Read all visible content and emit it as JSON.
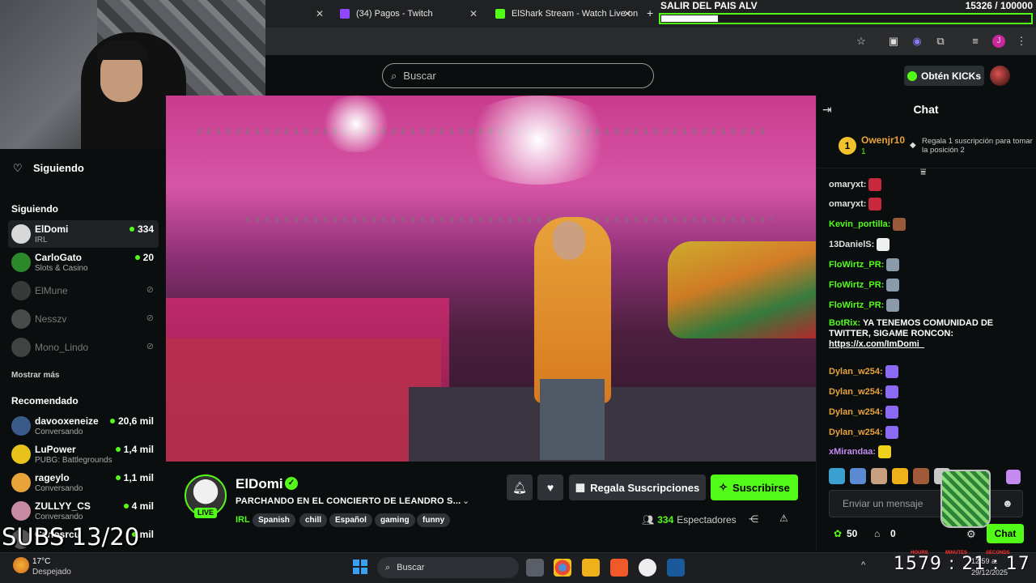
{
  "browser": {
    "tabs": [
      {
        "label": "(34) Pagos - Twitch",
        "favicon_color": "#9146ff"
      },
      {
        "label": "ElShark Stream - Watch Live on",
        "favicon_color": "#53fc18"
      }
    ],
    "new_tab_icon": "plus-icon",
    "toolbar_icons": [
      "star-icon",
      "media-icon",
      "vpn-icon",
      "extensions-icon",
      "reading-list-icon",
      "profile-icon",
      "kebab-menu-icon"
    ],
    "profile_initial": "J"
  },
  "overlay_goal": {
    "title": "SALIR DEL PAIS ALV",
    "count": "15326 / 100000",
    "progress": 0.153
  },
  "header": {
    "search_placeholder": "Buscar",
    "kicks_label": "Obtén KICKs"
  },
  "sidebar": {
    "following_label": "Siguiendo",
    "following_section": "Siguiendo",
    "following": [
      {
        "name": "ElDomi",
        "sub": "IRL",
        "viewers": "334",
        "live": true,
        "color": "#d8d8d8"
      },
      {
        "name": "CarloGato",
        "sub": "Slots & Casino",
        "viewers": "20",
        "live": true,
        "color": "#2a8a2a"
      },
      {
        "name": "ElMune",
        "live": false,
        "color": "#666"
      },
      {
        "name": "Nesszv",
        "live": false,
        "color": "#888"
      },
      {
        "name": "Mono_Lindo",
        "live": false,
        "color": "#777"
      }
    ],
    "show_more": "Mostrar más",
    "recommended_section": "Recomendado",
    "recommended": [
      {
        "name": "davooxeneize",
        "sub": "Conversando",
        "viewers": "20,6 mil",
        "color": "#3a5a8a"
      },
      {
        "name": "LuPower",
        "sub": "PUBG: Battlegrounds",
        "viewers": "1,4 mil",
        "color": "#e8c21a"
      },
      {
        "name": "rageylo",
        "sub": "Conversando",
        "viewers": "1,1 mil",
        "color": "#e8a23a"
      },
      {
        "name": "ZULLYY_CS",
        "sub": "Conversando",
        "viewers": "4 mil",
        "color": "#c88aa0"
      },
      {
        "name": "Carlosrcu",
        "sub": "",
        "viewers": "mil",
        "color": "#555"
      }
    ]
  },
  "stream": {
    "streamer": "ElDomi",
    "live_label": "LIVE",
    "title": "PARCHANDO EN EL CONCIERTO DE LEANDRO S...",
    "category": "IRL",
    "tags": [
      "Spanish",
      "chill",
      "Español",
      "gaming",
      "funny"
    ],
    "gift_label": "Regala Suscripciones",
    "subscribe_label": "Suscribirse",
    "viewers": "334",
    "viewers_label": "Espectadores",
    "subs_overlay": "SUBS 13/20"
  },
  "chat": {
    "title": "Chat",
    "pinned": {
      "rank": "1",
      "user": "Owenjr10",
      "count": "1",
      "text": "Regala 1 suscripción para tomar la posición 2"
    },
    "messages": [
      {
        "user": "omaryxt:",
        "color": "#e0e0e0",
        "text": "",
        "emote": "#c8283c"
      },
      {
        "user": "omaryxt:",
        "color": "#e0e0e0",
        "text": "",
        "emote": "#c8283c"
      },
      {
        "user": "Kevin_portilla:",
        "color": "#53fc18",
        "text": "",
        "emote": "#9a5a3a"
      },
      {
        "user": "13DanielS:",
        "color": "#e0e0e0",
        "text": "",
        "emote": "#f0f0f0"
      },
      {
        "user": "FloWirtz_PR:",
        "color": "#53fc18",
        "text": "",
        "emote": "#8a9aaa"
      },
      {
        "user": "FloWirtz_PR:",
        "color": "#53fc18",
        "text": "",
        "emote": "#8a9aaa"
      },
      {
        "user": "FloWirtz_PR:",
        "color": "#53fc18",
        "text": "",
        "emote": "#8a9aaa"
      },
      {
        "user": "BotRix:",
        "color": "#53fc18",
        "text": "YA TENEMOS COMUNIDAD DE TWITTER, SIGAME RONCON:",
        "link": "https://x.com/ImDomi_"
      },
      {
        "user": "Dylan_w254:",
        "color": "#e8a23a",
        "text": "",
        "emote": "#8a6af0"
      },
      {
        "user": "Dylan_w254:",
        "color": "#e8a23a",
        "text": "",
        "emote": "#8a6af0"
      },
      {
        "user": "Dylan_w254:",
        "color": "#e8a23a",
        "text": "",
        "emote": "#8a6af0"
      },
      {
        "user": "Dylan_w254:",
        "color": "#e8a23a",
        "text": "",
        "emote": "#8a6af0"
      },
      {
        "user": "xMirandaa:",
        "color": "#c48af0",
        "text": "",
        "emote": "#f0d21a"
      }
    ],
    "input_placeholder": "Enviar un mensaje",
    "points": "50",
    "gift_points": "0",
    "chat_button": "Chat"
  },
  "taskbar": {
    "temp": "17°C",
    "weather": "Despejado",
    "search_label": "Buscar",
    "time": "12:59 a.",
    "date": "29/12/2025",
    "timer": "1579 : 21 : 17",
    "timer_labels": [
      "HOURS",
      "MINUTES",
      "SECONDS"
    ]
  }
}
